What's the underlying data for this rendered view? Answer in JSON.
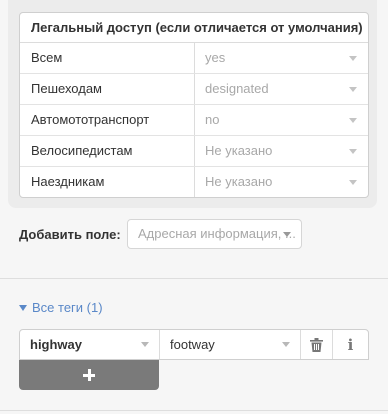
{
  "access": {
    "header": "Легальный доступ (если отличается от умолчания)",
    "rows": [
      {
        "label": "Всем",
        "value": "yes"
      },
      {
        "label": "Пешеходам",
        "value": "designated"
      },
      {
        "label": "Автомототранспорт",
        "value": "no"
      },
      {
        "label": "Велосипедистам",
        "value": "Не указано"
      },
      {
        "label": "Наездникам",
        "value": "Не указано"
      }
    ]
  },
  "add_field": {
    "label": "Добавить поле:",
    "placeholder": "Адресная информация, ..."
  },
  "tags": {
    "toggle_label": "Все теги (1)",
    "rows": [
      {
        "key": "highway",
        "value": "footway"
      }
    ]
  },
  "icons": {
    "delete": "trash-icon",
    "info": "info-icon",
    "add": "plus-icon"
  }
}
